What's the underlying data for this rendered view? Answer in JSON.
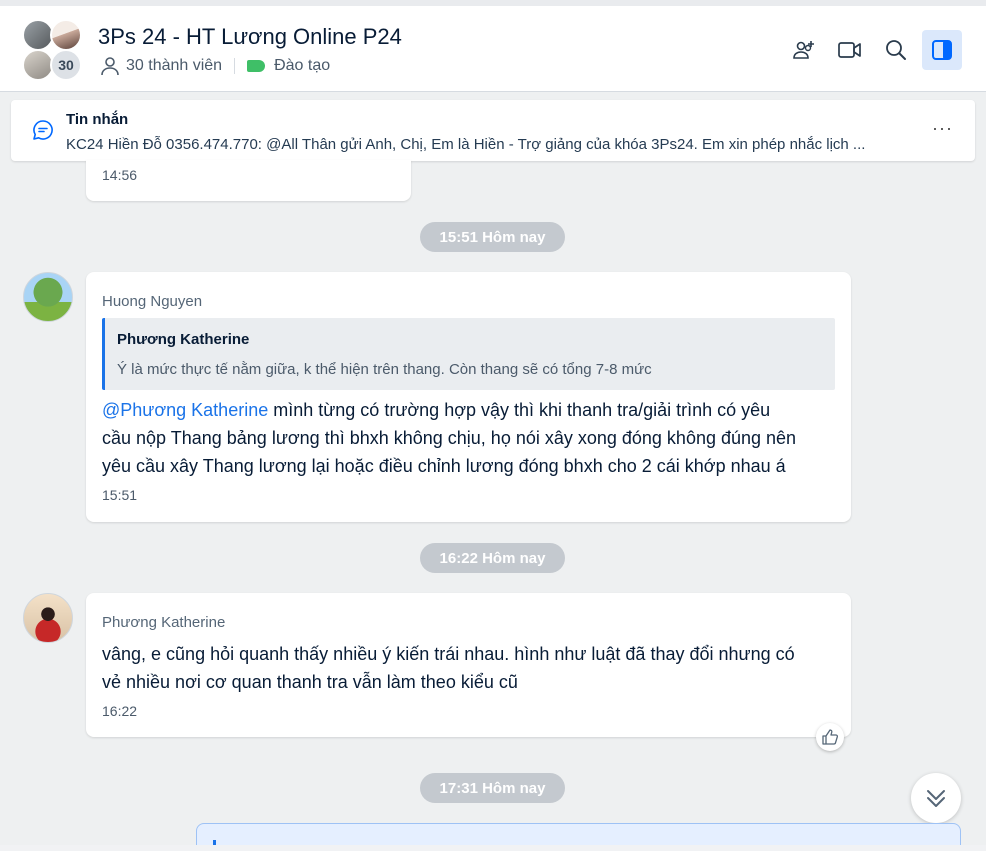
{
  "header": {
    "title": "3Ps 24 - HT Lương Online P24",
    "member_count_badge": "30",
    "members_label": "30 thành viên",
    "tag_label": "Đào tạo",
    "tag_color": "#3fbf67",
    "actions": [
      "add-member-icon",
      "video-call-icon",
      "search-icon",
      "sidebar-toggle-icon"
    ]
  },
  "pinned": {
    "title": "Tin nhắn",
    "text": "KC24 Hiền Đỗ 0356.474.770: @All Thân gửi Anh, Chị, Em là Hiền - Trợ giảng của khóa 3Ps24. Em xin phép nhắc lịch ...",
    "more": "···"
  },
  "messages": {
    "partial_time": "14:56",
    "divider1": "15:51 Hôm nay",
    "m1": {
      "sender": "Huong Nguyen",
      "quote_name": "Phương Katherine",
      "quote_text": "Ý là mức thực tế nằm giữa, k thể hiện trên thang. Còn thang sẽ có tổng 7-8 mức",
      "mention": "@Phương Katherine",
      "text_line1": " mình từng có trường hợp vậy thì khi thanh tra/giải trình có yêu",
      "text_line2": "cầu nộp Thang bảng lương thì bhxh không chịu, họ nói xây xong đóng không đúng nên",
      "text_line3": "yêu cầu xây Thang lương lại hoặc điều chỉnh lương đóng bhxh cho 2 cái khớp nhau á",
      "time": "15:51"
    },
    "divider2": "16:22 Hôm nay",
    "m2": {
      "sender": "Phương Katherine",
      "text_line1": "vâng, e cũng hỏi quanh thấy nhiều ý kiến trái nhau. hình như luật đã thay đổi nhưng có",
      "text_line2": "vẻ nhiều nơi cơ quan thanh tra vẫn làm theo kiểu cũ",
      "time": "16:22"
    },
    "divider3": "17:31 Hôm nay"
  },
  "colors": {
    "accent": "#1a73e8",
    "divider_bg": "#c4c9cf",
    "chat_bg": "#eef0f1"
  }
}
